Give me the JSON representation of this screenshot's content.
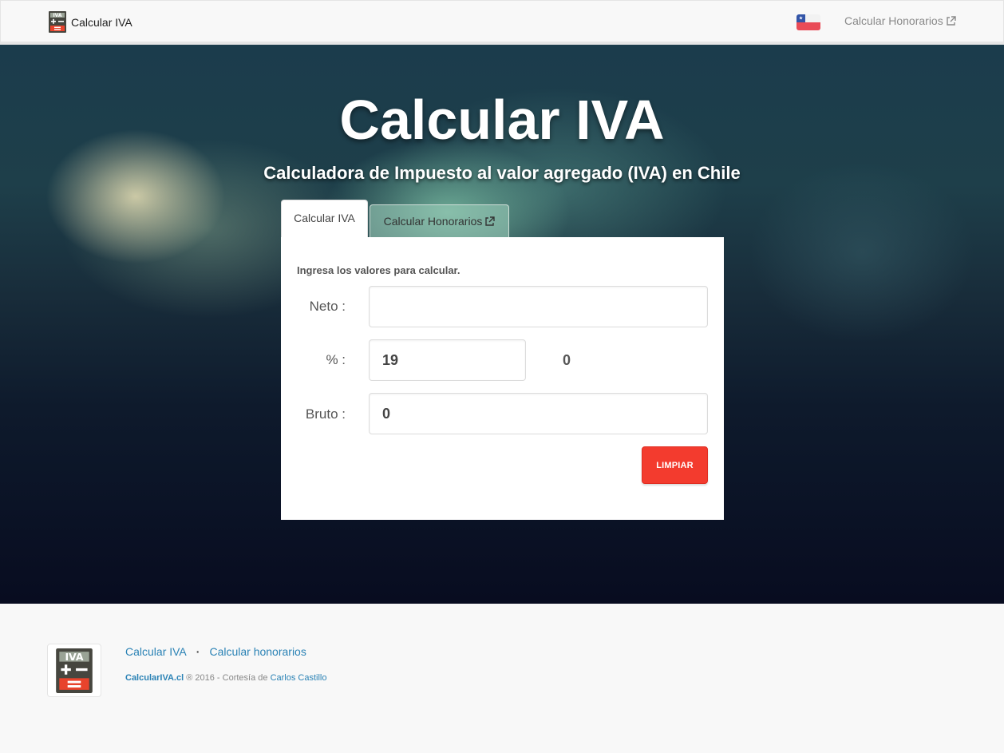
{
  "navbar": {
    "brand_label": "Calcular IVA",
    "link_label": "Calcular Honorarios"
  },
  "hero": {
    "title": "Calcular IVA",
    "subtitle": "Calculadora de Impuesto al valor agregado (IVA) en Chile"
  },
  "tabs": [
    {
      "label": "Calcular IVA",
      "active": true
    },
    {
      "label": "Calcular Honorarios",
      "active": false
    }
  ],
  "form": {
    "intro": "Ingresa los valores para calcular.",
    "neto_label": "Neto :",
    "neto_value": "",
    "percent_label": "% :",
    "percent_value": "19",
    "iva_amount": "0",
    "bruto_label": "Bruto :",
    "bruto_value": "0",
    "clear_label": "LIMPIAR"
  },
  "footer": {
    "link_iva": "Calcular IVA",
    "separator": "·",
    "link_honorarios": "Calcular honorarios",
    "site_name": "CalcularIVA.cl",
    "copyright": " ® 2016 - Cortesía de ",
    "author": "Carlos Castillo"
  },
  "logo": {
    "text": "IVA"
  },
  "colors": {
    "accent_red": "#f33b2e",
    "link_blue": "#2a82b5",
    "logo_dark": "#46463f",
    "logo_red": "#e8432c"
  },
  "icons": [
    "calculator-logo-icon",
    "chile-flag-icon",
    "external-link-icon"
  ]
}
